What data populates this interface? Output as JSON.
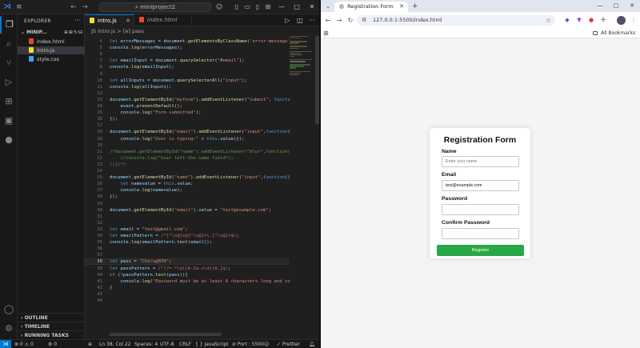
{
  "vscode": {
    "search_text": "miniproject2",
    "explorer": {
      "title": "EXPLORER",
      "project": "MINIP...",
      "files": [
        {
          "name": "index.html",
          "color": "#e44d26"
        },
        {
          "name": "intro.js",
          "color": "#f1dd35"
        },
        {
          "name": "style.css",
          "color": "#42a5f5"
        }
      ],
      "sections": [
        "OUTLINE",
        "TIMELINE",
        "RUNNING TASKS"
      ]
    },
    "tabs": [
      {
        "label": "intro.js",
        "color": "#f1dd35"
      },
      {
        "label": "index.html",
        "color": "#e44d26"
      }
    ],
    "breadcrumb": "JS intro.js > [e] pass",
    "status": {
      "problems": "⊗ 0 ⚠ 0",
      "problems_sub": "⚙ 0",
      "position": "Ln 38, Col 22",
      "spaces": "Spaces: 4",
      "encoding": "UTF-8",
      "eol": "CRLF",
      "language": "{ } JavaScript",
      "port": "⊘ Port : 5500",
      "prettier": "✓ Prettier"
    },
    "code_lines": [
      {
        "n": "4",
        "html": "<span class=\"kw\">let</span> <span class=\"vr\">errorMessages</span> = <span class=\"vr\">document</span>.<span class=\"fn\">getElementsByClassName</span>(<span class=\"st\">'error-message'</span>);"
      },
      {
        "n": "5",
        "html": "<span class=\"vr\">console</span>.<span class=\"fn\">log</span>(<span class=\"vr\">errorMessages</span>);"
      },
      {
        "n": "6",
        "html": ""
      },
      {
        "n": "7",
        "html": "<span class=\"kw\">let</span> <span class=\"vr\">emailInput</span> = <span class=\"vr\">document</span>.<span class=\"fn\">querySelector</span>(<span class=\"st\">\"#email\"</span>);"
      },
      {
        "n": "8",
        "html": "<span class=\"vr\">console</span>.<span class=\"fn\">log</span>(<span class=\"vr\">emailInput</span>);"
      },
      {
        "n": "9",
        "html": ""
      },
      {
        "n": "10",
        "html": "<span class=\"kw\">let</span> <span class=\"vr\">allInputs</span> = <span class=\"vr\">document</span>.<span class=\"fn\">querySelectorAll</span>(<span class=\"st\">\"input\"</span>);"
      },
      {
        "n": "11",
        "html": "<span class=\"vr\">console</span>.<span class=\"fn\">log</span>(<span class=\"vr\">allInputs</span>);"
      },
      {
        "n": "12",
        "html": ""
      },
      {
        "n": "13",
        "html": "<span class=\"vr\">document</span>.<span class=\"fn\">getElementById</span>(<span class=\"st\">\"myform\"</span>).<span class=\"fn\">addEventListener</span>(<span class=\"st\">\"submit\"</span>, <span class=\"kw\">function</span>(<span class=\"vr\">event</span>){"
      },
      {
        "n": "14",
        "html": "    <span class=\"vr\">event</span>.<span class=\"fn\">preventDefault</span>();"
      },
      {
        "n": "15",
        "html": "    <span class=\"vr\">console</span>.<span class=\"fn\">log</span>(<span class=\"st\">\"Form submitted\"</span>);"
      },
      {
        "n": "16",
        "html": "});"
      },
      {
        "n": "17",
        "html": ""
      },
      {
        "n": "18",
        "html": "<span class=\"vr\">document</span>.<span class=\"fn\">getElementById</span>(<span class=\"st\">\"email\"</span>).<span class=\"fn\">addEventListener</span>(<span class=\"st\">\"input\"</span>,<span class=\"kw\">function</span>(){"
      },
      {
        "n": "19",
        "html": "    <span class=\"vr\">console</span>.<span class=\"fn\">log</span>(<span class=\"st\">\"User is typing:\"</span> + <span class=\"kw\">this</span>.<span class=\"vr\">value</span>)});"
      },
      {
        "n": "20",
        "html": ""
      },
      {
        "n": "21",
        "html": "<span class=\"cm\">/*document.getElementById(\"name\").addEventListener(\"blur\",function(){</span>"
      },
      {
        "n": "22",
        "html": "<span class=\"cm\">    //console.log(\"User left the name field\");</span>"
      },
      {
        "n": "23",
        "html": "<span class=\"cm\">//})*/</span>"
      },
      {
        "n": "24",
        "html": ""
      },
      {
        "n": "25",
        "html": "<span class=\"vr\">document</span>.<span class=\"fn\">getElementById</span>(<span class=\"st\">\"name\"</span>).<span class=\"fn\">addEventListener</span>(<span class=\"st\">\"input\"</span>,<span class=\"kw\">function</span>(){"
      },
      {
        "n": "26",
        "html": "    <span class=\"kw\">let</span> <span class=\"vr\">namevalue</span> = <span class=\"kw\">this</span>.<span class=\"vr\">value</span>;"
      },
      {
        "n": "27",
        "html": "    <span class=\"vr\">console</span>.<span class=\"fn\">log</span>(<span class=\"vr\">namevalue</span>);"
      },
      {
        "n": "28",
        "html": "});"
      },
      {
        "n": "29",
        "html": ""
      },
      {
        "n": "30",
        "html": "<span class=\"vr\">document</span>.<span class=\"fn\">getElementById</span>(<span class=\"st\">\"email\"</span>).<span class=\"vr\">value</span> = <span class=\"st\">\"test@example.com\"</span>;"
      },
      {
        "n": "31",
        "html": ""
      },
      {
        "n": "32",
        "html": ""
      },
      {
        "n": "33",
        "html": "<span class=\"kw\">let</span> <span class=\"vr\">email</span> = <span class=\"st\">\"test@gmail.com\"</span>;"
      },
      {
        "n": "34",
        "html": "<span class=\"kw\">let</span> <span class=\"vr\">emailPattern</span> = <span class=\"rx\">/^[^\\s@]+@[^\\s@]+\\.[^\\s@]+$/</span>;"
      },
      {
        "n": "35",
        "html": "<span class=\"vr\">console</span>.<span class=\"fn\">log</span>(<span class=\"vr\">emailPattern</span>.<span class=\"fn\">test</span>(<span class=\"vr\">email</span>));"
      },
      {
        "n": "36",
        "html": ""
      },
      {
        "n": "37",
        "html": ""
      },
      {
        "n": "38",
        "html": "<span class=\"kw\">let</span> <span class=\"vr\">pass</span> = <span class=\"st\">\"Chiru@039\"</span>;"
      },
      {
        "n": "39",
        "html": "<span class=\"kw\">let</span> <span class=\"vr\">passPattern</span> = <span class=\"rx\">/^(?=.*\\d)[A-Za-z\\d]{6,}$/</span>;"
      },
      {
        "n": "40",
        "html": "<span class=\"ctl\">if</span> (!<span class=\"vr\">passPattern</span>.<span class=\"fn\">test</span>(<span class=\"vr\">pass</span>)){"
      },
      {
        "n": "41",
        "html": "    <span class=\"vr\">console</span>.<span class=\"fn\">log</span>(<span class=\"st\">\"Password must be at least 6 characters long and co</span>"
      },
      {
        "n": "42",
        "html": "}"
      },
      {
        "n": "43",
        "html": ""
      },
      {
        "n": "44",
        "html": ""
      }
    ],
    "current_line": "38"
  },
  "browser": {
    "tab_title": "Registration Form",
    "url": "127.0.0.1:5500/index.html",
    "bookmarks_label": "All Bookmarks",
    "form": {
      "title": "Registration Form",
      "name_label": "Name",
      "name_placeholder": "Enter your name",
      "email_label": "Email",
      "email_value": "test@example.com",
      "password_label": "Password",
      "confirm_label": "Confirm Password",
      "button_label": "Register",
      "button_color": "#28a745"
    }
  }
}
